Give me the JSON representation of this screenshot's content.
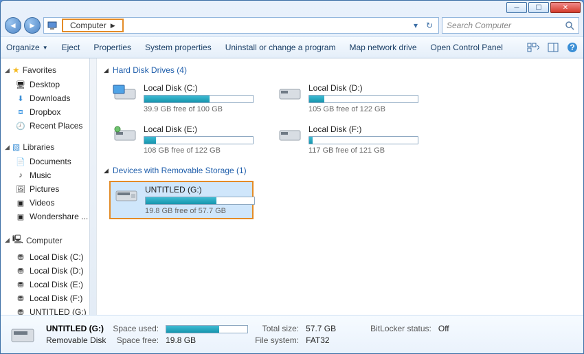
{
  "window": {
    "min_tip": "Minimize",
    "max_tip": "Maximize",
    "close_tip": "Close"
  },
  "breadcrumb": {
    "root": "Computer"
  },
  "search": {
    "placeholder": "Search Computer"
  },
  "toolbar": {
    "organize": "Organize",
    "eject": "Eject",
    "properties": "Properties",
    "system_properties": "System properties",
    "uninstall": "Uninstall or change a program",
    "map_drive": "Map network drive",
    "control_panel": "Open Control Panel"
  },
  "sidebar": {
    "favorites": {
      "label": "Favorites",
      "items": [
        "Desktop",
        "Downloads",
        "Dropbox",
        "Recent Places"
      ]
    },
    "libraries": {
      "label": "Libraries",
      "items": [
        "Documents",
        "Music",
        "Pictures",
        "Videos",
        "Wondershare ..."
      ]
    },
    "computer": {
      "label": "Computer",
      "items": [
        "Local Disk (C:)",
        "Local Disk (D:)",
        "Local Disk (E:)",
        "Local Disk (F:)",
        "UNTITLED (G:)"
      ]
    }
  },
  "sections": {
    "hdd": {
      "label": "Hard Disk Drives (4)"
    },
    "removable": {
      "label": "Devices with Removable Storage (1)"
    }
  },
  "drives": {
    "c": {
      "name": "Local Disk (C:)",
      "free_text": "39.9 GB free of 100 GB",
      "fill_pct": 60
    },
    "d": {
      "name": "Local Disk (D:)",
      "free_text": "105 GB free of 122 GB",
      "fill_pct": 14
    },
    "e": {
      "name": "Local Disk (E:)",
      "free_text": "108 GB free of 122 GB",
      "fill_pct": 11
    },
    "f": {
      "name": "Local Disk (F:)",
      "free_text": "117 GB free of 121 GB",
      "fill_pct": 3
    },
    "g": {
      "name": "UNTITLED (G:)",
      "free_text": "19.8 GB free of 57.7 GB",
      "fill_pct": 65
    }
  },
  "status": {
    "title": "UNTITLED (G:)",
    "subtitle": "Removable Disk",
    "labels": {
      "space_used": "Space used:",
      "space_free": "Space free:",
      "total_size": "Total size:",
      "file_system": "File system:",
      "bitlocker": "BitLocker status:"
    },
    "values": {
      "space_free": "19.8 GB",
      "total_size": "57.7 GB",
      "file_system": "FAT32",
      "bitlocker": "Off"
    },
    "used_pct": 65
  }
}
